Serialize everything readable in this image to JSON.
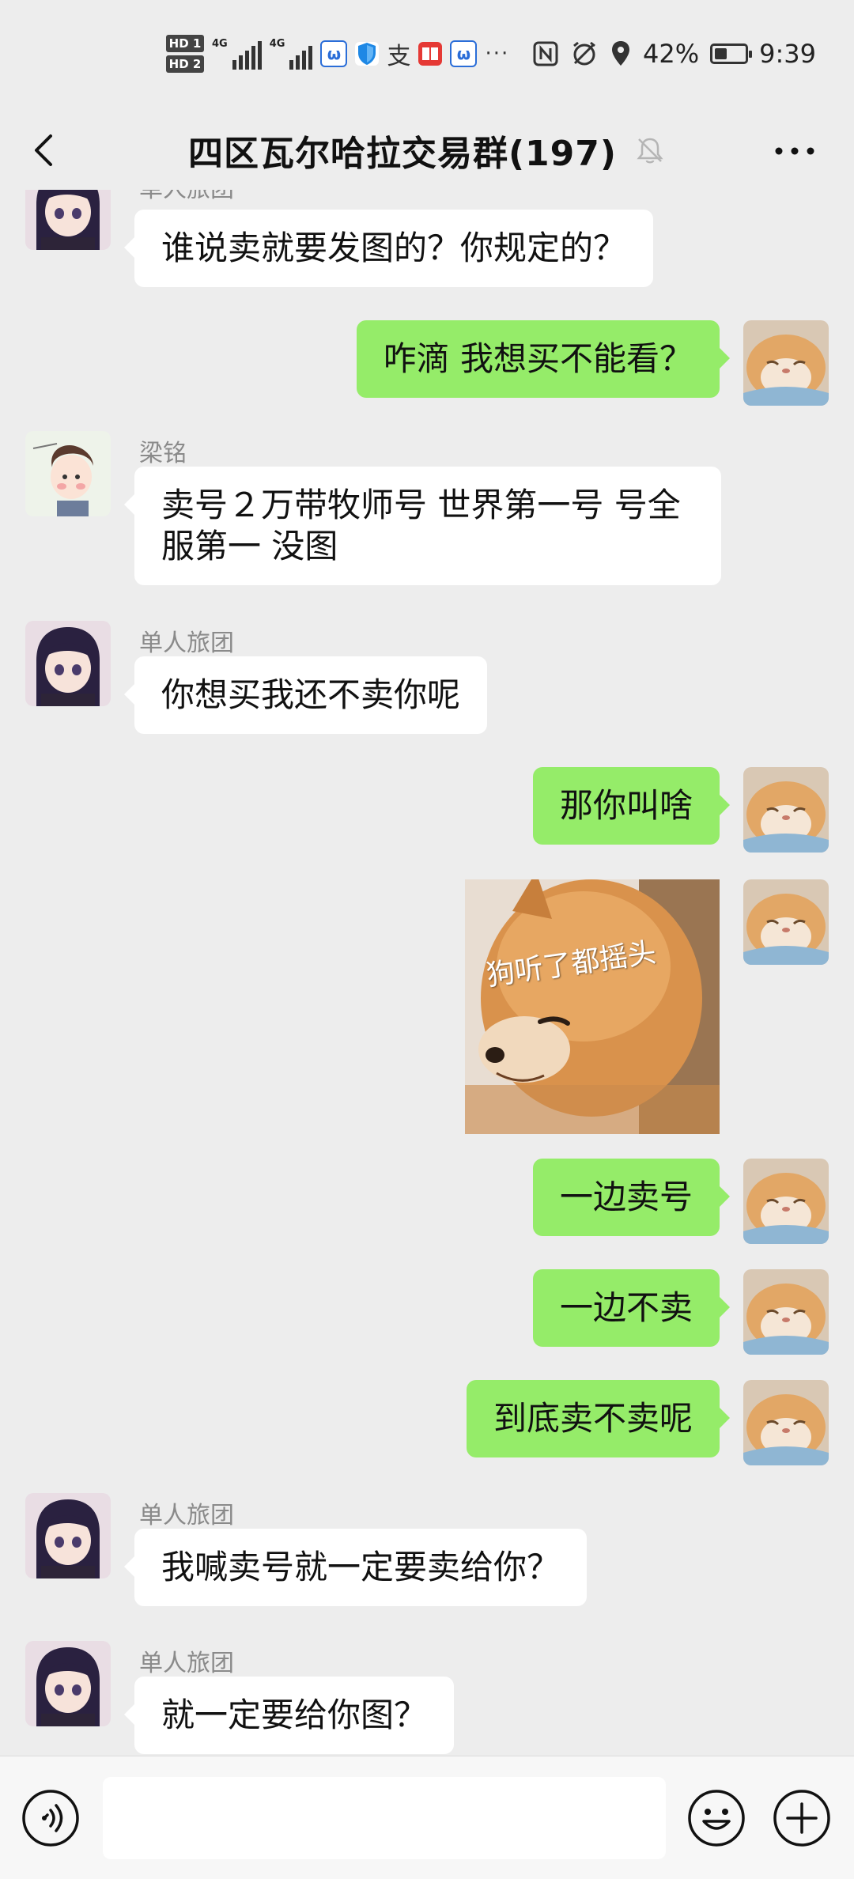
{
  "status_bar": {
    "hd_labels": [
      "HD 1",
      "HD 2"
    ],
    "network_labels": [
      "4G",
      "4G"
    ],
    "battery_percent": 42,
    "battery_text": "42%",
    "time": "9:39",
    "more_notifications": "···"
  },
  "header": {
    "title": "四区瓦尔哈拉交易群(197)",
    "icons": {
      "back": "back-arrow-icon",
      "mute": "bell-muted-icon",
      "more": "more-dots-icon"
    }
  },
  "messages": [
    {
      "sender": "单人旅团",
      "text": "谁说卖就要发图的？你规定的？",
      "direction": "in",
      "avatar": "anime-girl"
    },
    {
      "text": "咋滴 我想买不能看？",
      "direction": "out",
      "avatar": "cat"
    },
    {
      "sender": "梁铭",
      "text": "卖号２万带牧师号 世界第一号 号全服第一  没图",
      "direction": "in",
      "avatar": "chibi-boy"
    },
    {
      "sender": "单人旅团",
      "text": "你想买我还不卖你呢",
      "direction": "in",
      "avatar": "anime-girl"
    },
    {
      "text": "那你叫啥",
      "direction": "out",
      "avatar": "cat"
    },
    {
      "sticker_text": "狗听了都摇头",
      "direction": "out",
      "avatar": "cat"
    },
    {
      "text": "一边卖号",
      "direction": "out",
      "avatar": "cat"
    },
    {
      "text": "一边不卖",
      "direction": "out",
      "avatar": "cat"
    },
    {
      "text": "到底卖不卖呢",
      "direction": "out",
      "avatar": "cat"
    },
    {
      "sender": "单人旅团",
      "text": "我喊卖号就一定要卖给你？",
      "direction": "in",
      "avatar": "anime-girl"
    },
    {
      "sender": "单人旅团",
      "text": "就一定要给你图？",
      "direction": "in",
      "avatar": "anime-girl"
    }
  ],
  "input_bar": {
    "icons": {
      "voice": "voice-icon",
      "emoji": "emoji-icon",
      "plus": "plus-icon"
    },
    "input_value": ""
  },
  "colors": {
    "background": "#ededed",
    "outgoing_bubble": "#95ec69",
    "incoming_bubble": "#ffffff"
  }
}
